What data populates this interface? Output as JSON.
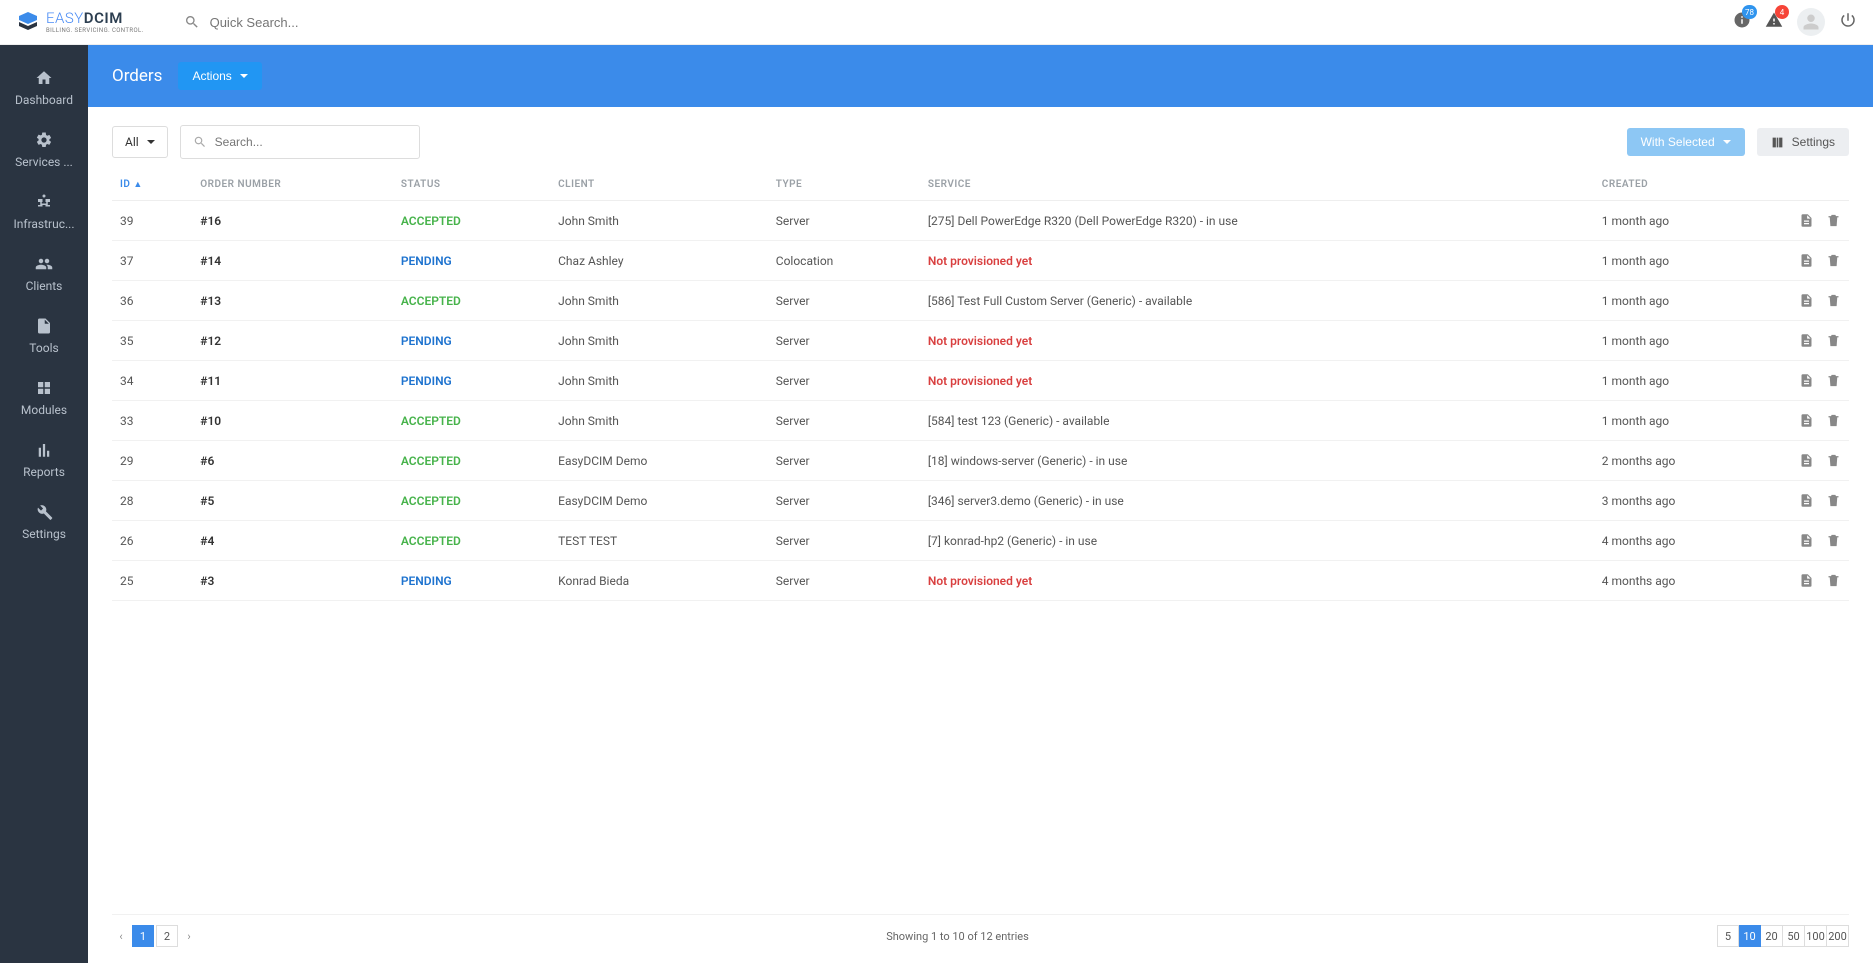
{
  "brand": {
    "easy": "EASY",
    "dcim": "DCIM",
    "tagline": "BILLING. SERVICING. CONTROL."
  },
  "topbar": {
    "search_placeholder": "Quick Search...",
    "notif_count": "78",
    "alert_count": "4"
  },
  "sidebar": {
    "items": [
      {
        "label": "Dashboard",
        "icon": "home"
      },
      {
        "label": "Services ...",
        "icon": "gear"
      },
      {
        "label": "Infrastruc...",
        "icon": "sitemap"
      },
      {
        "label": "Clients",
        "icon": "users"
      },
      {
        "label": "Tools",
        "icon": "file"
      },
      {
        "label": "Modules",
        "icon": "grid"
      },
      {
        "label": "Reports",
        "icon": "chart"
      },
      {
        "label": "Settings",
        "icon": "wrench"
      }
    ]
  },
  "header": {
    "title": "Orders",
    "actions_label": "Actions"
  },
  "toolbar": {
    "filter_label": "All",
    "search_placeholder": "Search...",
    "with_selected_label": "With Selected",
    "settings_label": "Settings"
  },
  "table": {
    "columns": [
      "ID",
      "ORDER NUMBER",
      "STATUS",
      "CLIENT",
      "TYPE",
      "SERVICE",
      "CREATED"
    ],
    "rows": [
      {
        "id": "39",
        "num": "#16",
        "status": "ACCEPTED",
        "client": "John Smith",
        "type": "Server",
        "service": "[275] Dell PowerEdge R320 (Dell PowerEdge R320) - in use",
        "svc_none": false,
        "created": "1 month ago"
      },
      {
        "id": "37",
        "num": "#14",
        "status": "PENDING",
        "client": "Chaz Ashley",
        "type": "Colocation",
        "service": "Not provisioned yet",
        "svc_none": true,
        "created": "1 month ago"
      },
      {
        "id": "36",
        "num": "#13",
        "status": "ACCEPTED",
        "client": "John Smith",
        "type": "Server",
        "service": "[586] Test Full Custom Server (Generic) - available",
        "svc_none": false,
        "created": "1 month ago"
      },
      {
        "id": "35",
        "num": "#12",
        "status": "PENDING",
        "client": "John Smith",
        "type": "Server",
        "service": "Not provisioned yet",
        "svc_none": true,
        "created": "1 month ago"
      },
      {
        "id": "34",
        "num": "#11",
        "status": "PENDING",
        "client": "John Smith",
        "type": "Server",
        "service": "Not provisioned yet",
        "svc_none": true,
        "created": "1 month ago"
      },
      {
        "id": "33",
        "num": "#10",
        "status": "ACCEPTED",
        "client": "John Smith",
        "type": "Server",
        "service": "[584] test 123 (Generic) - available",
        "svc_none": false,
        "created": "1 month ago"
      },
      {
        "id": "29",
        "num": "#6",
        "status": "ACCEPTED",
        "client": "EasyDCIM Demo",
        "type": "Server",
        "service": "[18] windows-server (Generic) - in use",
        "svc_none": false,
        "created": "2 months ago"
      },
      {
        "id": "28",
        "num": "#5",
        "status": "ACCEPTED",
        "client": "EasyDCIM Demo",
        "type": "Server",
        "service": "[346] server3.demo (Generic) - in use",
        "svc_none": false,
        "created": "3 months ago"
      },
      {
        "id": "26",
        "num": "#4",
        "status": "ACCEPTED",
        "client": "TEST TEST",
        "type": "Server",
        "service": "[7] konrad-hp2 (Generic) - in use",
        "svc_none": false,
        "created": "4 months ago"
      },
      {
        "id": "25",
        "num": "#3",
        "status": "PENDING",
        "client": "Konrad Bieda",
        "type": "Server",
        "service": "Not provisioned yet",
        "svc_none": true,
        "created": "4 months ago"
      }
    ]
  },
  "footer": {
    "pages": [
      "1",
      "2"
    ],
    "active_page": "1",
    "info": "Showing 1 to 10 of 12 entries",
    "page_sizes": [
      "5",
      "10",
      "20",
      "50",
      "100",
      "200"
    ],
    "active_size": "10"
  }
}
